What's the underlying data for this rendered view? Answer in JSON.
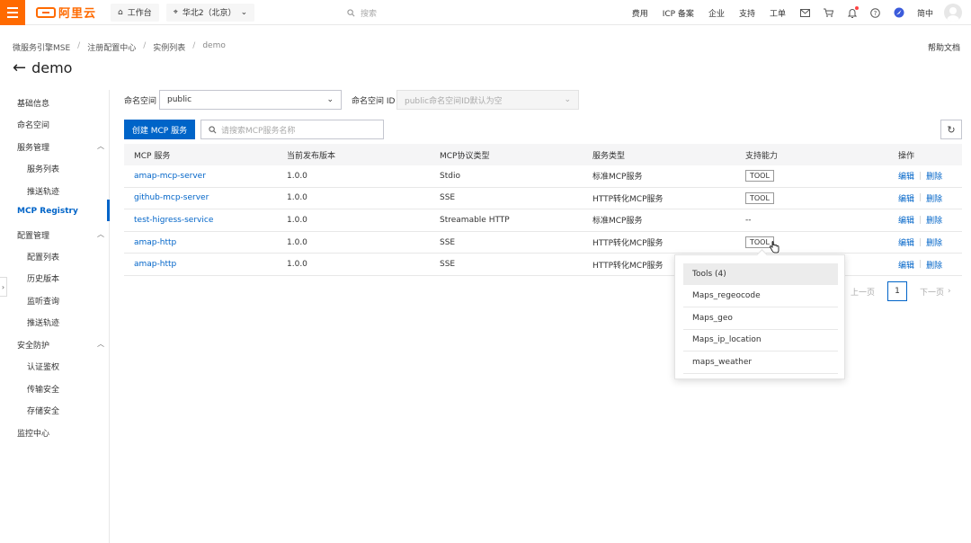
{
  "topbar": {
    "logo_text": "阿里云",
    "home_label": "工作台",
    "region_label": "华北2（北京）",
    "search_placeholder": "搜索",
    "nav_links": [
      "费用",
      "ICP 备案",
      "企业",
      "支持",
      "工单"
    ],
    "lang_label": "简中",
    "icons": [
      "mail-icon",
      "cart-icon",
      "bell-icon",
      "help-icon",
      "globe-icon"
    ]
  },
  "breadcrumb": {
    "items": [
      "微服务引擎MSE",
      "注册配置中心",
      "实例列表",
      "demo"
    ],
    "help_label": "帮助文档"
  },
  "page": {
    "title": "demo"
  },
  "sidebar": {
    "basic": "基础信息",
    "namespace": "命名空间",
    "service_mgmt": "服务管理",
    "service_list": "服务列表",
    "push_trace": "推送轨迹",
    "mcp_registry": "MCP Registry",
    "config_mgmt": "配置管理",
    "config_list": "配置列表",
    "history": "历史版本",
    "listen_query": "监听查询",
    "config_push_trace": "推送轨迹",
    "security": "安全防护",
    "auth": "认证鉴权",
    "transport": "传输安全",
    "storage": "存储安全",
    "monitor": "监控中心"
  },
  "filters": {
    "namespace_label": "命名空间",
    "namespace_value": "public",
    "namespace_id_label": "命名空间 ID",
    "namespace_id_placeholder": "public命名空间ID默认为空"
  },
  "actions": {
    "create_label": "创建 MCP 服务",
    "search_placeholder": "请搜索MCP服务名称"
  },
  "table": {
    "headers": [
      "MCP 服务",
      "当前发布版本",
      "MCP协议类型",
      "服务类型",
      "支持能力",
      "操作"
    ],
    "rows": [
      {
        "name": "amap-mcp-server",
        "version": "1.0.0",
        "protocol": "Stdio",
        "type": "标准MCP服务",
        "capability": "TOOL"
      },
      {
        "name": "github-mcp-server",
        "version": "1.0.0",
        "protocol": "SSE",
        "type": "HTTP转化MCP服务",
        "capability": "TOOL"
      },
      {
        "name": "test-higress-service",
        "version": "1.0.0",
        "protocol": "Streamable HTTP",
        "type": "标准MCP服务",
        "capability": "--"
      },
      {
        "name": "amap-http",
        "version": "1.0.0",
        "protocol": "SSE",
        "type": "HTTP转化MCP服务",
        "capability": "TOOL"
      },
      {
        "name": "amap-http",
        "version": "1.0.0",
        "protocol": "SSE",
        "type": "HTTP转化MCP服务",
        "capability": ""
      }
    ],
    "edit_label": "编辑",
    "delete_label": "删除"
  },
  "pagination": {
    "prev_label": "上一页",
    "current_page": "1",
    "next_label": "下一页"
  },
  "popover": {
    "title": "Tools (4)",
    "items": [
      "Maps_regeocode",
      "Maps_geo",
      "Maps_ip_location",
      "maps_weather"
    ]
  },
  "colors": {
    "brand": "#ff6a00",
    "primary": "#0064c8"
  }
}
